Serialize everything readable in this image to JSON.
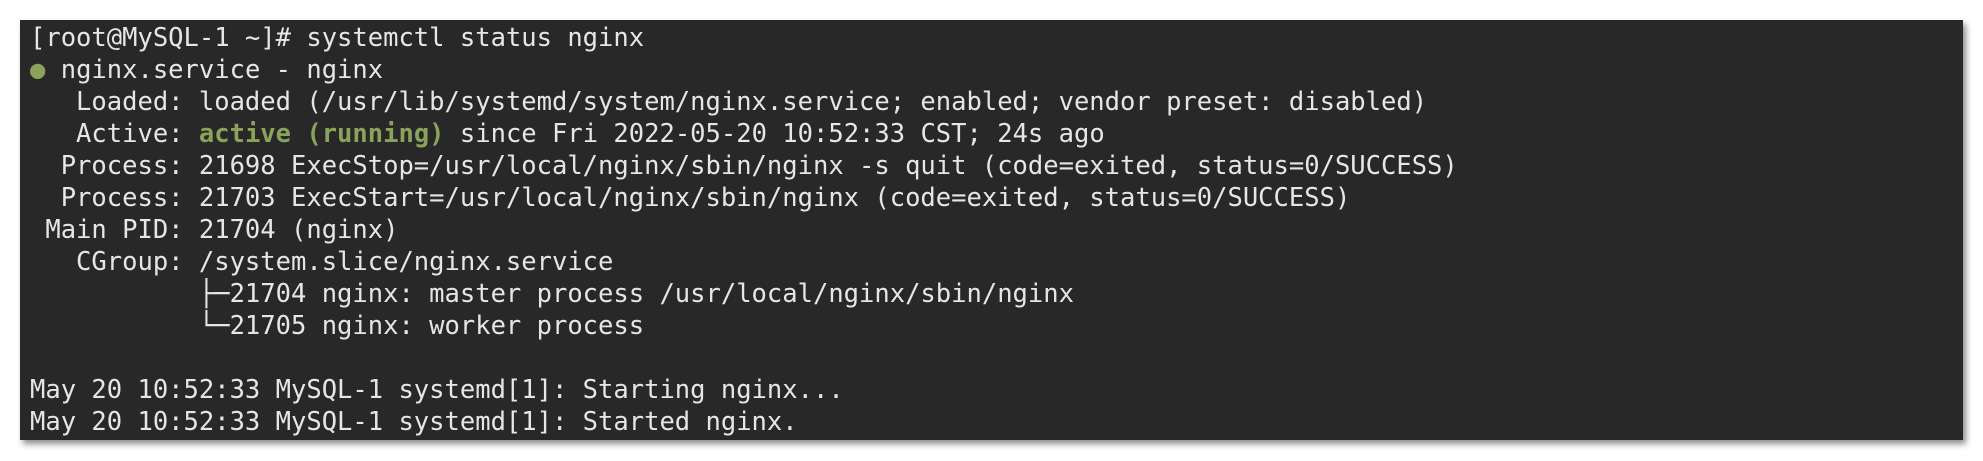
{
  "terminal": {
    "prompt_line": "[root@MySQL-1 ~]# systemctl status nginx",
    "service_dot": "●",
    "service_line": " nginx.service - nginx",
    "loaded_line": "   Loaded: loaded (/usr/lib/systemd/system/nginx.service; enabled; vendor preset: disabled)",
    "active_label": "   Active: ",
    "active_status": "active (running)",
    "active_rest": " since Fri 2022-05-20 10:52:33 CST; 24s ago",
    "process1_line": "  Process: 21698 ExecStop=/usr/local/nginx/sbin/nginx -s quit (code=exited, status=0/SUCCESS)",
    "process2_line": "  Process: 21703 ExecStart=/usr/local/nginx/sbin/nginx (code=exited, status=0/SUCCESS)",
    "mainpid_line": " Main PID: 21704 (nginx)",
    "cgroup_line": "   CGroup: /system.slice/nginx.service",
    "cgroup_child1": "           ├─21704 nginx: master process /usr/local/nginx/sbin/nginx",
    "cgroup_child2": "           └─21705 nginx: worker process",
    "log_line1": "May 20 10:52:33 MySQL-1 systemd[1]: Starting nginx...",
    "log_line2": "May 20 10:52:33 MySQL-1 systemd[1]: Started nginx."
  },
  "colors": {
    "background": "#282828",
    "text": "#e6e6e6",
    "status_green": "#8aa25a"
  }
}
